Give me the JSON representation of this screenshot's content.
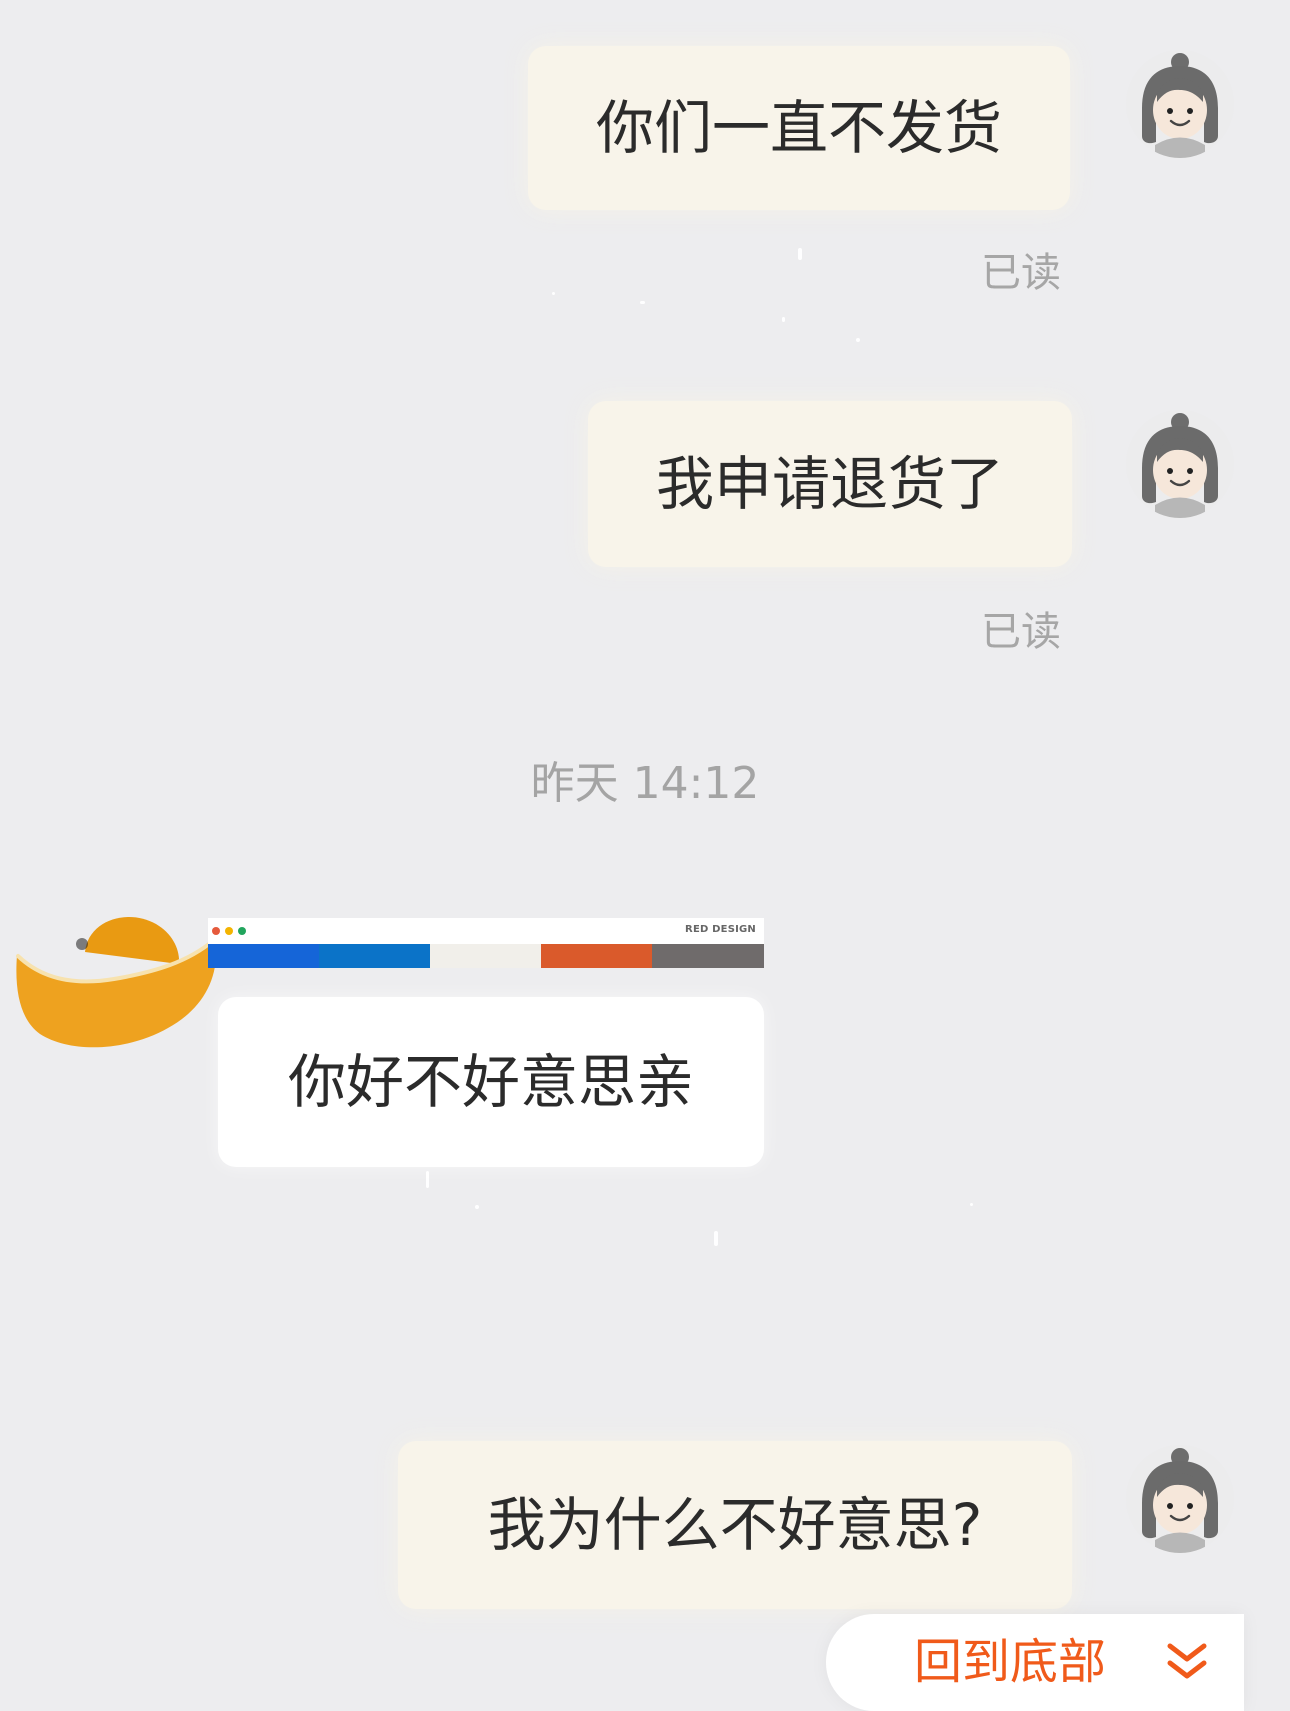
{
  "messages": [
    {
      "text": "你们一直不发货",
      "status": "已读"
    },
    {
      "text": "我申请退货了",
      "status": "已读"
    },
    {
      "text": "你好不好意思亲"
    },
    {
      "text": "我为什么不好意思?"
    }
  ],
  "timestamp": "昨天  14:12",
  "banner": {
    "label": "RED DESIGN",
    "dot_colors": [
      "#e55a3c",
      "#f4b400",
      "#21a55d"
    ],
    "strip_colors": [
      "#1565d8",
      "#0b73c8",
      "#f1efea",
      "#da5a2b",
      "#6f6b6b"
    ]
  },
  "return_bottom": {
    "label": "回到底部",
    "icon": "double-chevron-down-icon"
  },
  "colors": {
    "background": "#ededef",
    "outgoing_bubble": "#f8f4ea",
    "incoming_bubble": "#ffffff",
    "read_status": "#a6a6a6",
    "timestamp": "#a4a4a4",
    "accent": "#f05a1a",
    "ingot": "#eea21f"
  }
}
